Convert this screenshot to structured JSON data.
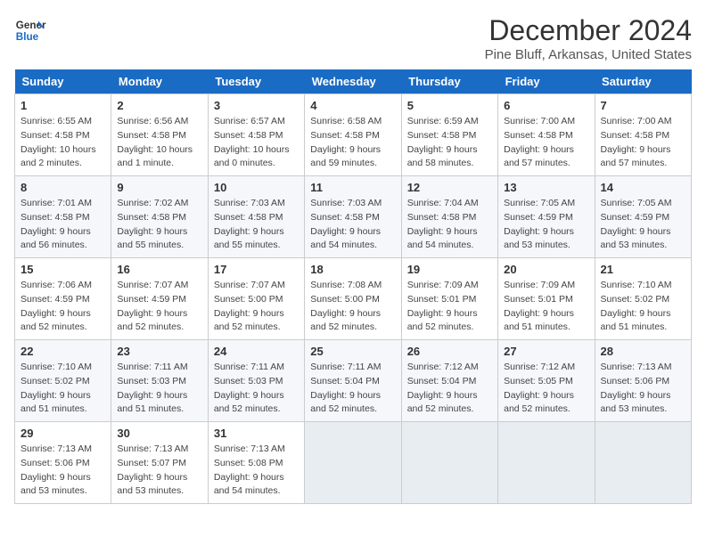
{
  "header": {
    "logo_general": "General",
    "logo_blue": "Blue",
    "month_title": "December 2024",
    "location": "Pine Bluff, Arkansas, United States"
  },
  "weekdays": [
    "Sunday",
    "Monday",
    "Tuesday",
    "Wednesday",
    "Thursday",
    "Friday",
    "Saturday"
  ],
  "weeks": [
    [
      {
        "day": "1",
        "sunrise": "6:55 AM",
        "sunset": "4:58 PM",
        "daylight": "10 hours and 2 minutes."
      },
      {
        "day": "2",
        "sunrise": "6:56 AM",
        "sunset": "4:58 PM",
        "daylight": "10 hours and 1 minute."
      },
      {
        "day": "3",
        "sunrise": "6:57 AM",
        "sunset": "4:58 PM",
        "daylight": "10 hours and 0 minutes."
      },
      {
        "day": "4",
        "sunrise": "6:58 AM",
        "sunset": "4:58 PM",
        "daylight": "9 hours and 59 minutes."
      },
      {
        "day": "5",
        "sunrise": "6:59 AM",
        "sunset": "4:58 PM",
        "daylight": "9 hours and 58 minutes."
      },
      {
        "day": "6",
        "sunrise": "7:00 AM",
        "sunset": "4:58 PM",
        "daylight": "9 hours and 57 minutes."
      },
      {
        "day": "7",
        "sunrise": "7:00 AM",
        "sunset": "4:58 PM",
        "daylight": "9 hours and 57 minutes."
      }
    ],
    [
      {
        "day": "8",
        "sunrise": "7:01 AM",
        "sunset": "4:58 PM",
        "daylight": "9 hours and 56 minutes."
      },
      {
        "day": "9",
        "sunrise": "7:02 AM",
        "sunset": "4:58 PM",
        "daylight": "9 hours and 55 minutes."
      },
      {
        "day": "10",
        "sunrise": "7:03 AM",
        "sunset": "4:58 PM",
        "daylight": "9 hours and 55 minutes."
      },
      {
        "day": "11",
        "sunrise": "7:03 AM",
        "sunset": "4:58 PM",
        "daylight": "9 hours and 54 minutes."
      },
      {
        "day": "12",
        "sunrise": "7:04 AM",
        "sunset": "4:58 PM",
        "daylight": "9 hours and 54 minutes."
      },
      {
        "day": "13",
        "sunrise": "7:05 AM",
        "sunset": "4:59 PM",
        "daylight": "9 hours and 53 minutes."
      },
      {
        "day": "14",
        "sunrise": "7:05 AM",
        "sunset": "4:59 PM",
        "daylight": "9 hours and 53 minutes."
      }
    ],
    [
      {
        "day": "15",
        "sunrise": "7:06 AM",
        "sunset": "4:59 PM",
        "daylight": "9 hours and 52 minutes."
      },
      {
        "day": "16",
        "sunrise": "7:07 AM",
        "sunset": "4:59 PM",
        "daylight": "9 hours and 52 minutes."
      },
      {
        "day": "17",
        "sunrise": "7:07 AM",
        "sunset": "5:00 PM",
        "daylight": "9 hours and 52 minutes."
      },
      {
        "day": "18",
        "sunrise": "7:08 AM",
        "sunset": "5:00 PM",
        "daylight": "9 hours and 52 minutes."
      },
      {
        "day": "19",
        "sunrise": "7:09 AM",
        "sunset": "5:01 PM",
        "daylight": "9 hours and 52 minutes."
      },
      {
        "day": "20",
        "sunrise": "7:09 AM",
        "sunset": "5:01 PM",
        "daylight": "9 hours and 51 minutes."
      },
      {
        "day": "21",
        "sunrise": "7:10 AM",
        "sunset": "5:02 PM",
        "daylight": "9 hours and 51 minutes."
      }
    ],
    [
      {
        "day": "22",
        "sunrise": "7:10 AM",
        "sunset": "5:02 PM",
        "daylight": "9 hours and 51 minutes."
      },
      {
        "day": "23",
        "sunrise": "7:11 AM",
        "sunset": "5:03 PM",
        "daylight": "9 hours and 51 minutes."
      },
      {
        "day": "24",
        "sunrise": "7:11 AM",
        "sunset": "5:03 PM",
        "daylight": "9 hours and 52 minutes."
      },
      {
        "day": "25",
        "sunrise": "7:11 AM",
        "sunset": "5:04 PM",
        "daylight": "9 hours and 52 minutes."
      },
      {
        "day": "26",
        "sunrise": "7:12 AM",
        "sunset": "5:04 PM",
        "daylight": "9 hours and 52 minutes."
      },
      {
        "day": "27",
        "sunrise": "7:12 AM",
        "sunset": "5:05 PM",
        "daylight": "9 hours and 52 minutes."
      },
      {
        "day": "28",
        "sunrise": "7:13 AM",
        "sunset": "5:06 PM",
        "daylight": "9 hours and 53 minutes."
      }
    ],
    [
      {
        "day": "29",
        "sunrise": "7:13 AM",
        "sunset": "5:06 PM",
        "daylight": "9 hours and 53 minutes."
      },
      {
        "day": "30",
        "sunrise": "7:13 AM",
        "sunset": "5:07 PM",
        "daylight": "9 hours and 53 minutes."
      },
      {
        "day": "31",
        "sunrise": "7:13 AM",
        "sunset": "5:08 PM",
        "daylight": "9 hours and 54 minutes."
      },
      null,
      null,
      null,
      null
    ]
  ],
  "labels": {
    "sunrise": "Sunrise:",
    "sunset": "Sunset:",
    "daylight": "Daylight:"
  }
}
